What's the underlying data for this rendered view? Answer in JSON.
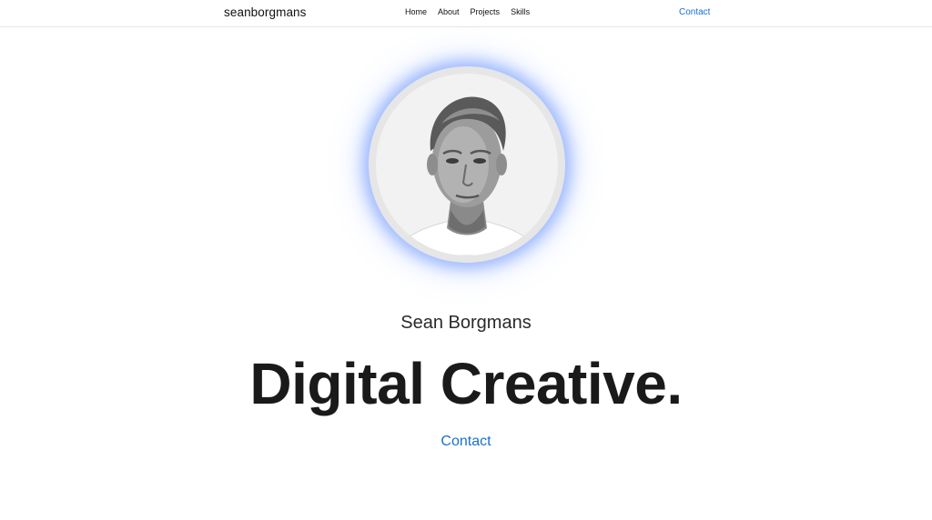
{
  "header": {
    "brand": "seanborgmans",
    "nav": [
      {
        "label": "Home"
      },
      {
        "label": "About"
      },
      {
        "label": "Projects"
      },
      {
        "label": "Skills"
      }
    ],
    "contact_label": "Contact"
  },
  "hero": {
    "avatar_icon": "portrait-photo",
    "name": "Sean Borgmans",
    "title": "Digital Creative.",
    "contact_label": "Contact"
  },
  "colors": {
    "accent": "#1a6fd1",
    "glow": "#5c8aff",
    "text": "#1a1a1a"
  }
}
